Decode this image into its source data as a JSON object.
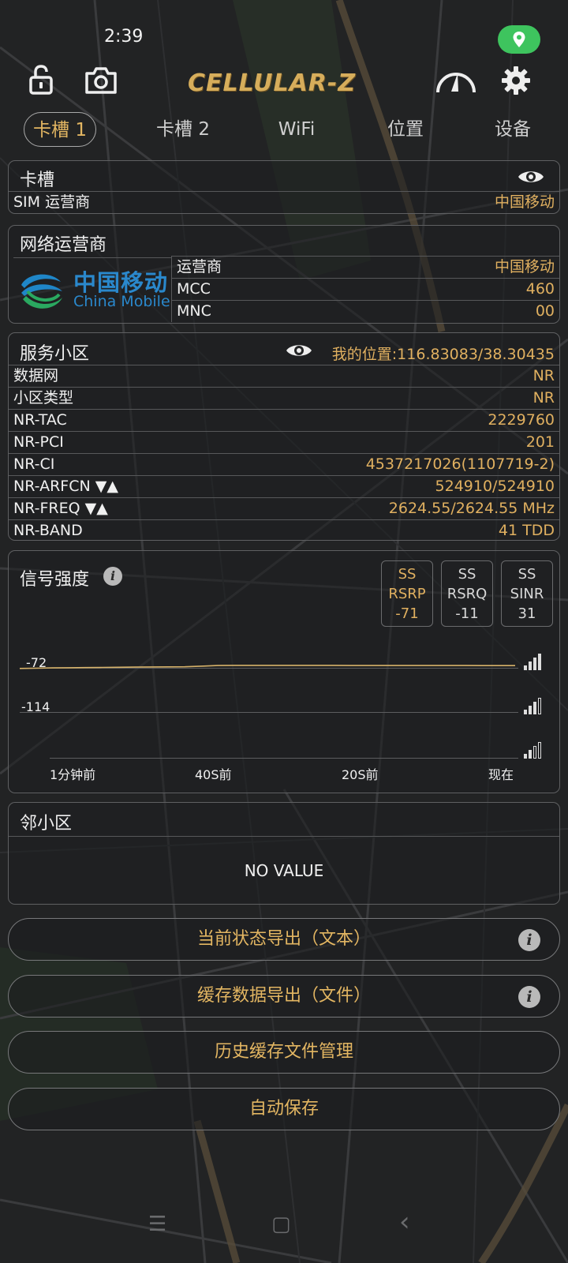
{
  "status": {
    "time": "2:39"
  },
  "app": {
    "logo": "CELLULAR-Z"
  },
  "tabs": [
    {
      "label": "卡槽 1",
      "active": true
    },
    {
      "label": "卡槽 2"
    },
    {
      "label": "WiFi"
    },
    {
      "label": "位置"
    },
    {
      "label": "设备"
    }
  ],
  "sim_panel": {
    "title": "卡槽",
    "rows": [
      {
        "k": "SIM 运营商",
        "v": "中国移动"
      }
    ]
  },
  "network_panel": {
    "title": "网络运营商",
    "logo_cn": "中国移动",
    "logo_en": "China Mobile",
    "rows": [
      {
        "k": "运营商",
        "v": "中国移动"
      },
      {
        "k": "MCC",
        "v": "460"
      },
      {
        "k": "MNC",
        "v": "00"
      }
    ]
  },
  "cell_panel": {
    "title": "服务小区",
    "location": "我的位置:116.83083/38.30435",
    "rows": [
      {
        "k": "数据网",
        "v": "NR"
      },
      {
        "k": "小区类型",
        "v": "NR"
      },
      {
        "k": "NR-TAC",
        "v": "2229760"
      },
      {
        "k": "NR-PCI",
        "v": "201"
      },
      {
        "k": "NR-CI",
        "v": "4537217026(1107719-2)"
      },
      {
        "k": "NR-ARFCN ▼▲",
        "v": "524910/524910"
      },
      {
        "k": "NR-FREQ ▼▲",
        "v": "2624.55/2624.55 MHz"
      },
      {
        "k": "NR-BAND",
        "v": "41 TDD"
      }
    ]
  },
  "signal_panel": {
    "title": "信号强度",
    "metrics": [
      {
        "l1": "SS",
        "l2": "RSRP",
        "val": "-71"
      },
      {
        "l1": "SS",
        "l2": "RSRQ",
        "val": "-11"
      },
      {
        "l1": "SS",
        "l2": "SINR",
        "val": "31"
      }
    ],
    "y_labels": [
      "-72",
      "-114"
    ],
    "x_labels": [
      "1分钟前",
      "40S前",
      "20S前",
      "现在"
    ]
  },
  "chart_data": {
    "type": "line",
    "title": "信号强度",
    "x": [
      "1分钟前",
      "40S前",
      "20S前",
      "现在"
    ],
    "series": [
      {
        "values": [
          -72.6,
          -72.4,
          -72.1,
          -71.9,
          -71.8,
          -71.6,
          -71.5,
          -71.3,
          -71.2,
          -71.1,
          -71.0,
          -70.4,
          -69.8,
          -69.7,
          -69.7,
          -69.7,
          -69.7,
          -69.7,
          -69.7,
          -69.7,
          -69.8,
          -69.8,
          -69.8,
          -69.8,
          -69.8,
          -69.8,
          -69.8,
          -69.8,
          -69.9,
          -69.9,
          -69.9
        ],
        "color": "#d6b26a"
      }
    ],
    "y_ticks": [
      -72,
      -114
    ],
    "ylim": [
      -156,
      -50
    ],
    "grid": true
  },
  "neighbor_panel": {
    "title": "邻小区",
    "empty": "NO VALUE"
  },
  "buttons": [
    {
      "label": "当前状态导出（文本）",
      "info": "i"
    },
    {
      "label": "缓存数据导出（文件）",
      "info": "i"
    },
    {
      "label": "历史缓存文件管理"
    },
    {
      "label": "自动保存"
    }
  ],
  "nav": {
    "menu": "☰",
    "home": "▢",
    "back": "‹"
  }
}
